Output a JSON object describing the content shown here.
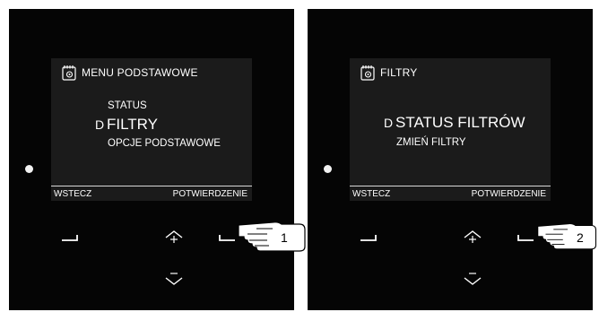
{
  "panels": [
    {
      "menu_title": "MENU PODSTAWOWE",
      "items": [
        "STATUS",
        "FILTRY",
        "OPCJE PODSTAWOWE"
      ],
      "soft_left": "WSTECZ",
      "soft_right": "POTWIERDZENIE",
      "callout": "1"
    },
    {
      "menu_title": "FILTRY",
      "items": [
        "STATUS FILTRÓW",
        "ZMIEŃ FILTRY"
      ],
      "soft_left": "WSTECZ",
      "soft_right": "POTWIERDZENIE",
      "callout": "2"
    }
  ],
  "icons": {
    "header": "calendar-gear-icon",
    "selection": "pointer-d-icon",
    "key_up": "plus-up-chevron-icon",
    "key_down": "minus-down-chevron-icon",
    "hand": "pointing-hand-icon"
  },
  "colors": {
    "bezel": "#050505",
    "screen": "#1b1b1b",
    "text": "#ffffff"
  }
}
